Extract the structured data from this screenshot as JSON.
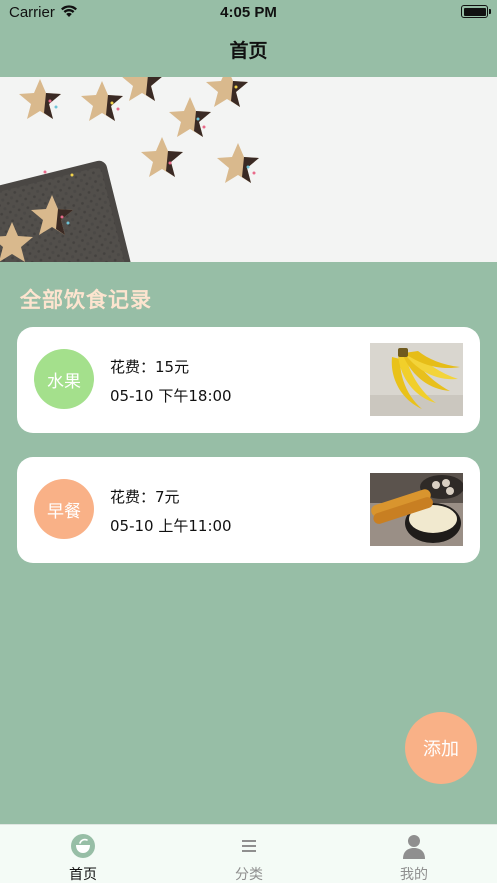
{
  "status_bar": {
    "carrier": "Carrier",
    "time": "4:05 PM"
  },
  "nav": {
    "title": "首页"
  },
  "section": {
    "title": "全部饮食记录"
  },
  "records": [
    {
      "category": "水果",
      "category_color": "#a4e08c",
      "cost": "花费：15元",
      "time": "05-10 下午18:00",
      "thumb": "banana-photo"
    },
    {
      "category": "早餐",
      "category_color": "#f9b187",
      "cost": "花费：7元",
      "time": "05-10 上午11:00",
      "thumb": "breakfast-photo"
    }
  ],
  "fab": {
    "label": "添加"
  },
  "tabbar": {
    "items": [
      {
        "label": "首页",
        "icon": "home-bowl-icon",
        "active": true
      },
      {
        "label": "分类",
        "icon": "list-icon",
        "active": false
      },
      {
        "label": "我的",
        "icon": "person-icon",
        "active": false
      }
    ]
  },
  "colors": {
    "background": "#97bea6",
    "section_title": "#fde4cf",
    "fab": "#f9b187",
    "tabbar": "#f4fbf6"
  }
}
